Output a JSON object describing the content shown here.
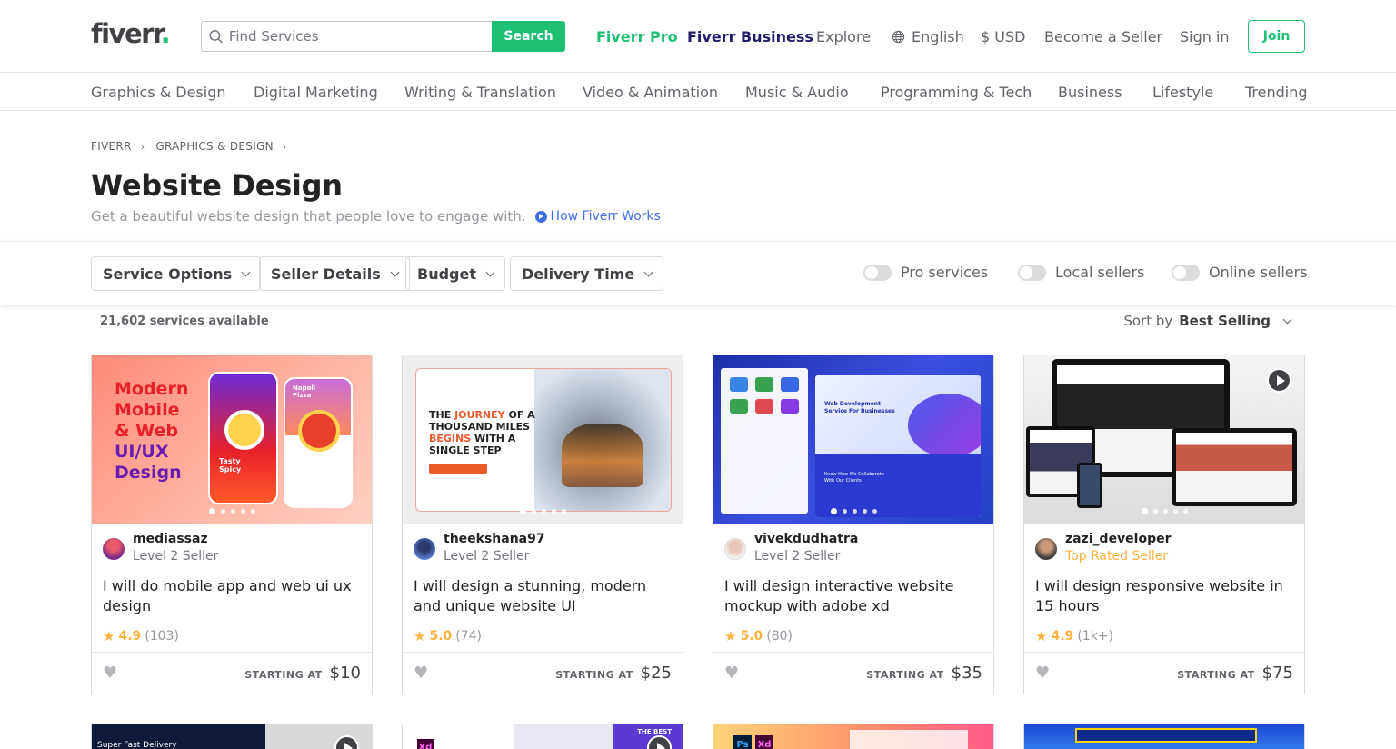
{
  "header": {
    "logo": "fiverr",
    "logo_dot": ".",
    "search_placeholder": "Find Services",
    "search_button": "Search",
    "fiverr_pro": "Fiverr Pro",
    "fiverr_business": "Fiverr Business",
    "explore": "Explore",
    "language": "English",
    "currency": "$ USD",
    "become_seller": "Become a Seller",
    "sign_in": "Sign in",
    "join": "Join"
  },
  "categories": [
    "Graphics & Design",
    "Digital Marketing",
    "Writing & Translation",
    "Video & Animation",
    "Music & Audio",
    "Programming & Tech",
    "Business",
    "Lifestyle",
    "Trending"
  ],
  "breadcrumb": [
    "FIVERR",
    "GRAPHICS & DESIGN"
  ],
  "page": {
    "title": "Website Design",
    "subtitle": "Get a beautiful website design that people love to engage with.",
    "how_link": "How Fiverr Works"
  },
  "filters": {
    "dropdowns": [
      "Service Options",
      "Seller Details",
      "Budget",
      "Delivery Time"
    ],
    "toggles": [
      "Pro services",
      "Local sellers",
      "Online sellers"
    ]
  },
  "results": {
    "count": "21,602 services available",
    "sort_label": "Sort by",
    "sort_value": "Best Selling"
  },
  "colors": {
    "brand_green": "#1dbf73",
    "business_navy": "#1f1c6b",
    "star": "#ffb33e",
    "link_blue": "#446ee7"
  },
  "gigs": [
    {
      "seller": "mediassaz",
      "level": "Level 2 Seller",
      "title": "I will do mobile app and web ui ux design",
      "rating": "4.9",
      "reviews": "(103)",
      "starting": "STARTING AT",
      "price": "$10",
      "thumb_text": [
        "Modern",
        "Mobile",
        "& Web",
        "UI/UX",
        "Design"
      ],
      "thumb_card_text": [
        "Tasty",
        "Spicy",
        "Napoli",
        "Pizza"
      ]
    },
    {
      "seller": "theekshana97",
      "level": "Level 2 Seller",
      "title": "I will design a stunning, modern and unique website UI",
      "rating": "5.0",
      "reviews": "(74)",
      "starting": "STARTING AT",
      "price": "$25",
      "thumb_text": [
        "THE",
        "JOURNEY",
        "OF A",
        "THOUSAND MILES",
        "BEGINS",
        "WITH A",
        "SINGLE STEP"
      ]
    },
    {
      "seller": "vivekdudhatra",
      "level": "Level 2 Seller",
      "title": "I will design interactive website mockup with adobe xd",
      "rating": "5.0",
      "reviews": "(80)",
      "starting": "STARTING AT",
      "price": "$35",
      "thumb_text": [
        "Web Development",
        "Service For Businesses",
        "Know How We Collaborate",
        "With Our Clients"
      ]
    },
    {
      "seller": "zazi_developer",
      "level": "Top Rated Seller",
      "title": "I will design responsive website in 15 hours",
      "rating": "4.9",
      "reviews": "(1k+)",
      "starting": "STARTING AT",
      "price": "$75"
    }
  ],
  "second_row": {
    "card1_text": "Super Fast Delivery",
    "card2_text": "THE BEST",
    "card2_badge": "Xd",
    "card3_badges": [
      "Ps",
      "Xd"
    ]
  }
}
